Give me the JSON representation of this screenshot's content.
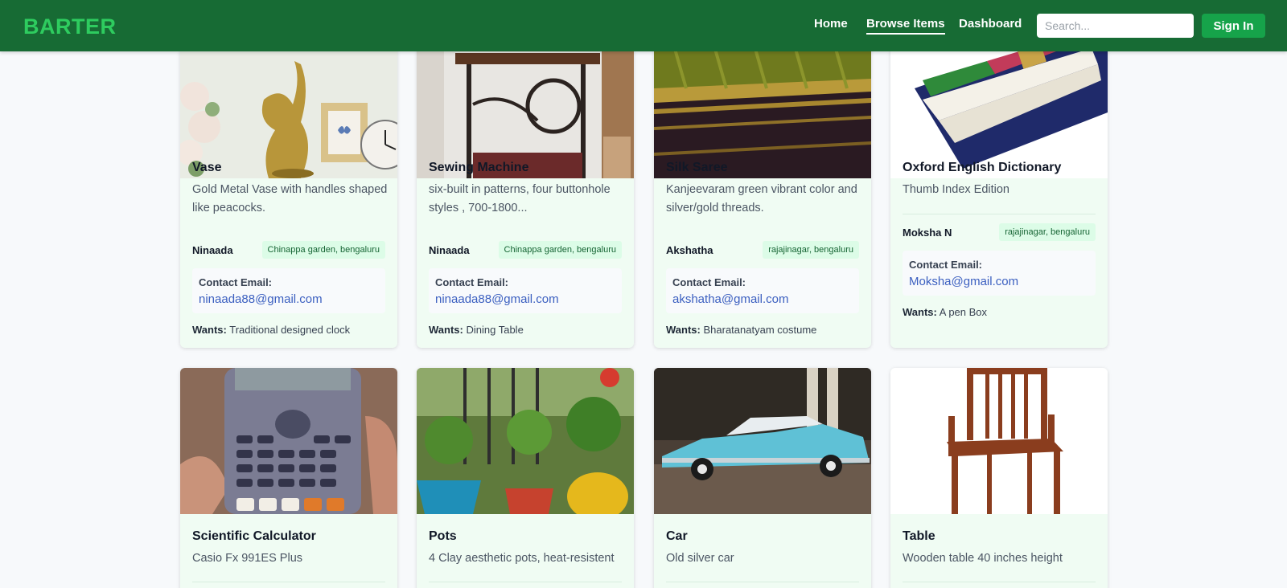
{
  "nav": {
    "logo": "BARTER",
    "links": [
      "Home",
      "Browse Items",
      "Dashboard"
    ],
    "search_placeholder": "Search...",
    "signin_label": "Sign In"
  },
  "labels": {
    "contact_email": "Contact Email:",
    "wants": "Wants:"
  },
  "items": [
    {
      "title": "Vase",
      "description": "Gold Metal Vase with handles shaped like peacocks.",
      "owner": "Ninaada",
      "location": "Chinappa garden, bengaluru",
      "email": "ninaada88@gmail.com",
      "wants": "Traditional designed clock",
      "image_icon": "vase-image"
    },
    {
      "title": "Sewing Machine",
      "description": "six-built in patterns, four buttonhole styles , 700-1800...",
      "owner": "Ninaada",
      "location": "Chinappa garden, bengaluru",
      "email": "ninaada88@gmail.com",
      "wants": "Dining Table",
      "image_icon": "sewing-machine-image"
    },
    {
      "title": "Silk Saree",
      "description": "Kanjeevaram green vibrant color and silver/gold threads.",
      "owner": "Akshatha",
      "location": "rajajinagar, bengaluru",
      "email": "akshatha@gmail.com",
      "wants": "Bharatanatyam costume",
      "image_icon": "saree-image"
    },
    {
      "title": "Oxford English Dictionary",
      "description": "Thumb Index Edition",
      "owner": "Moksha N",
      "location": "rajajinagar, bengaluru",
      "email": "Moksha@gmail.com",
      "wants": "A pen Box",
      "image_icon": "dictionary-image"
    },
    {
      "title": "Scientific Calculator",
      "description": "Casio Fx 991ES Plus",
      "image_icon": "calculator-image"
    },
    {
      "title": "Pots",
      "description": "4 Clay aesthetic pots, heat-resistent",
      "image_icon": "plant-pots-image"
    },
    {
      "title": "Car",
      "description": "Old silver car",
      "image_icon": "vintage-car-image"
    },
    {
      "title": "Table",
      "description": "Wooden table 40 inches height",
      "image_icon": "wooden-chair-image"
    }
  ]
}
